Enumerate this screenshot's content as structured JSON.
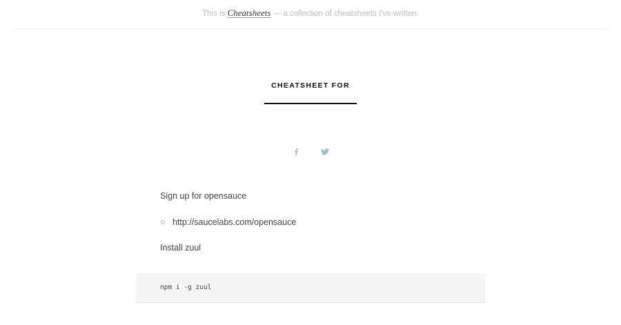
{
  "header": {
    "prefix": "This is",
    "brand": "Cheatsheets",
    "suffix": "— a collection of cheatsheets I've written."
  },
  "page": {
    "title": "CHEATSHEET FOR"
  },
  "social": {
    "icons": [
      "facebook-icon",
      "twitter-icon"
    ],
    "color": "#9bbfcb"
  },
  "content": {
    "step1": "Sign up for opensauce",
    "link": "http://saucelabs.com/opensauce",
    "step2": "Install zuul",
    "code": "npm i -g zuul"
  },
  "colors": {
    "bullet": "#a3c9c1",
    "code_bg": "#f4f5f6"
  }
}
